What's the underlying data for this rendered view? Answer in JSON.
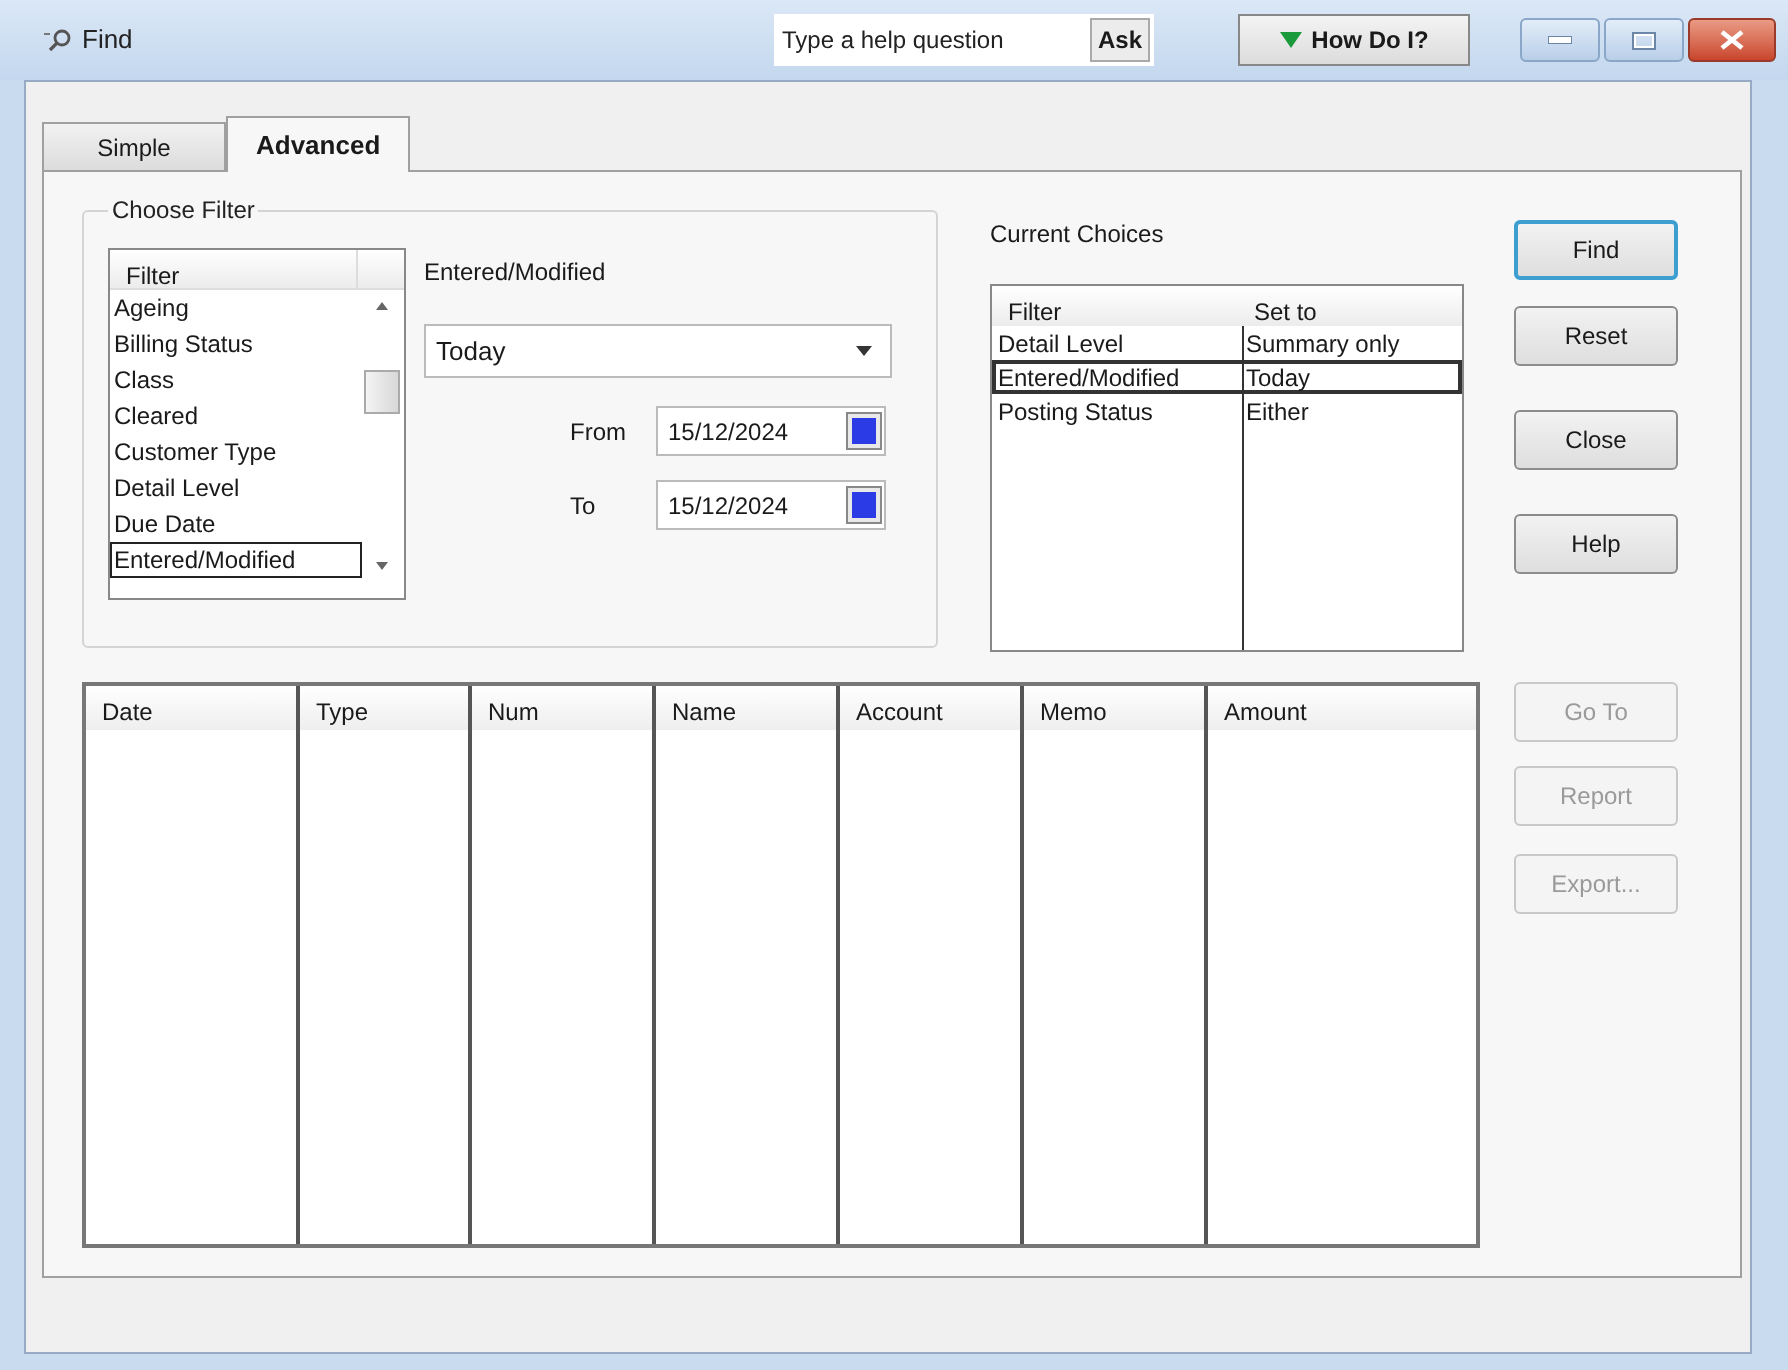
{
  "window": {
    "title": "Find",
    "help_field": {
      "placeholder": "Type a help question"
    },
    "ask_button": "Ask",
    "how_do_i_button": "How Do I?"
  },
  "tabs": [
    {
      "label": "Simple",
      "selected": false
    },
    {
      "label": "Advanced",
      "selected": true
    }
  ],
  "choose_filter": {
    "title": "Choose Filter",
    "list_header": "Filter",
    "items": [
      {
        "label": "Ageing",
        "selected": false
      },
      {
        "label": "Billing Status",
        "selected": false
      },
      {
        "label": "Class",
        "selected": false
      },
      {
        "label": "Cleared",
        "selected": false
      },
      {
        "label": "Customer Type",
        "selected": false
      },
      {
        "label": "Detail Level",
        "selected": false
      },
      {
        "label": "Due Date",
        "selected": false
      },
      {
        "label": "Entered/Modified",
        "selected": true
      }
    ],
    "filter_label": "Entered/Modified",
    "dropdown_value": "Today",
    "from_label": "From",
    "from_date": "15/12/2024",
    "to_label": "To",
    "to_date": "15/12/2024"
  },
  "current_choices": {
    "title": "Current Choices",
    "columns": [
      "Filter",
      "Set to"
    ],
    "rows": [
      {
        "filter": "Detail Level",
        "set_to": "Summary only",
        "selected": false
      },
      {
        "filter": "Entered/Modified",
        "set_to": "Today",
        "selected": true
      },
      {
        "filter": "Posting Status",
        "set_to": "Either",
        "selected": false
      }
    ]
  },
  "buttons": [
    {
      "label": "Find",
      "disabled": false,
      "default": true
    },
    {
      "label": "Reset",
      "disabled": false,
      "default": false
    },
    {
      "label": "Close",
      "disabled": false,
      "default": false
    },
    {
      "label": "Help",
      "disabled": false,
      "default": false
    }
  ],
  "results": {
    "columns": [
      "Date",
      "Type",
      "Num",
      "Name",
      "Account",
      "Memo",
      "Amount"
    ]
  },
  "result_buttons": [
    {
      "label": "Go To",
      "disabled": true
    },
    {
      "label": "Report",
      "disabled": true
    },
    {
      "label": "Export...",
      "disabled": true
    }
  ]
}
